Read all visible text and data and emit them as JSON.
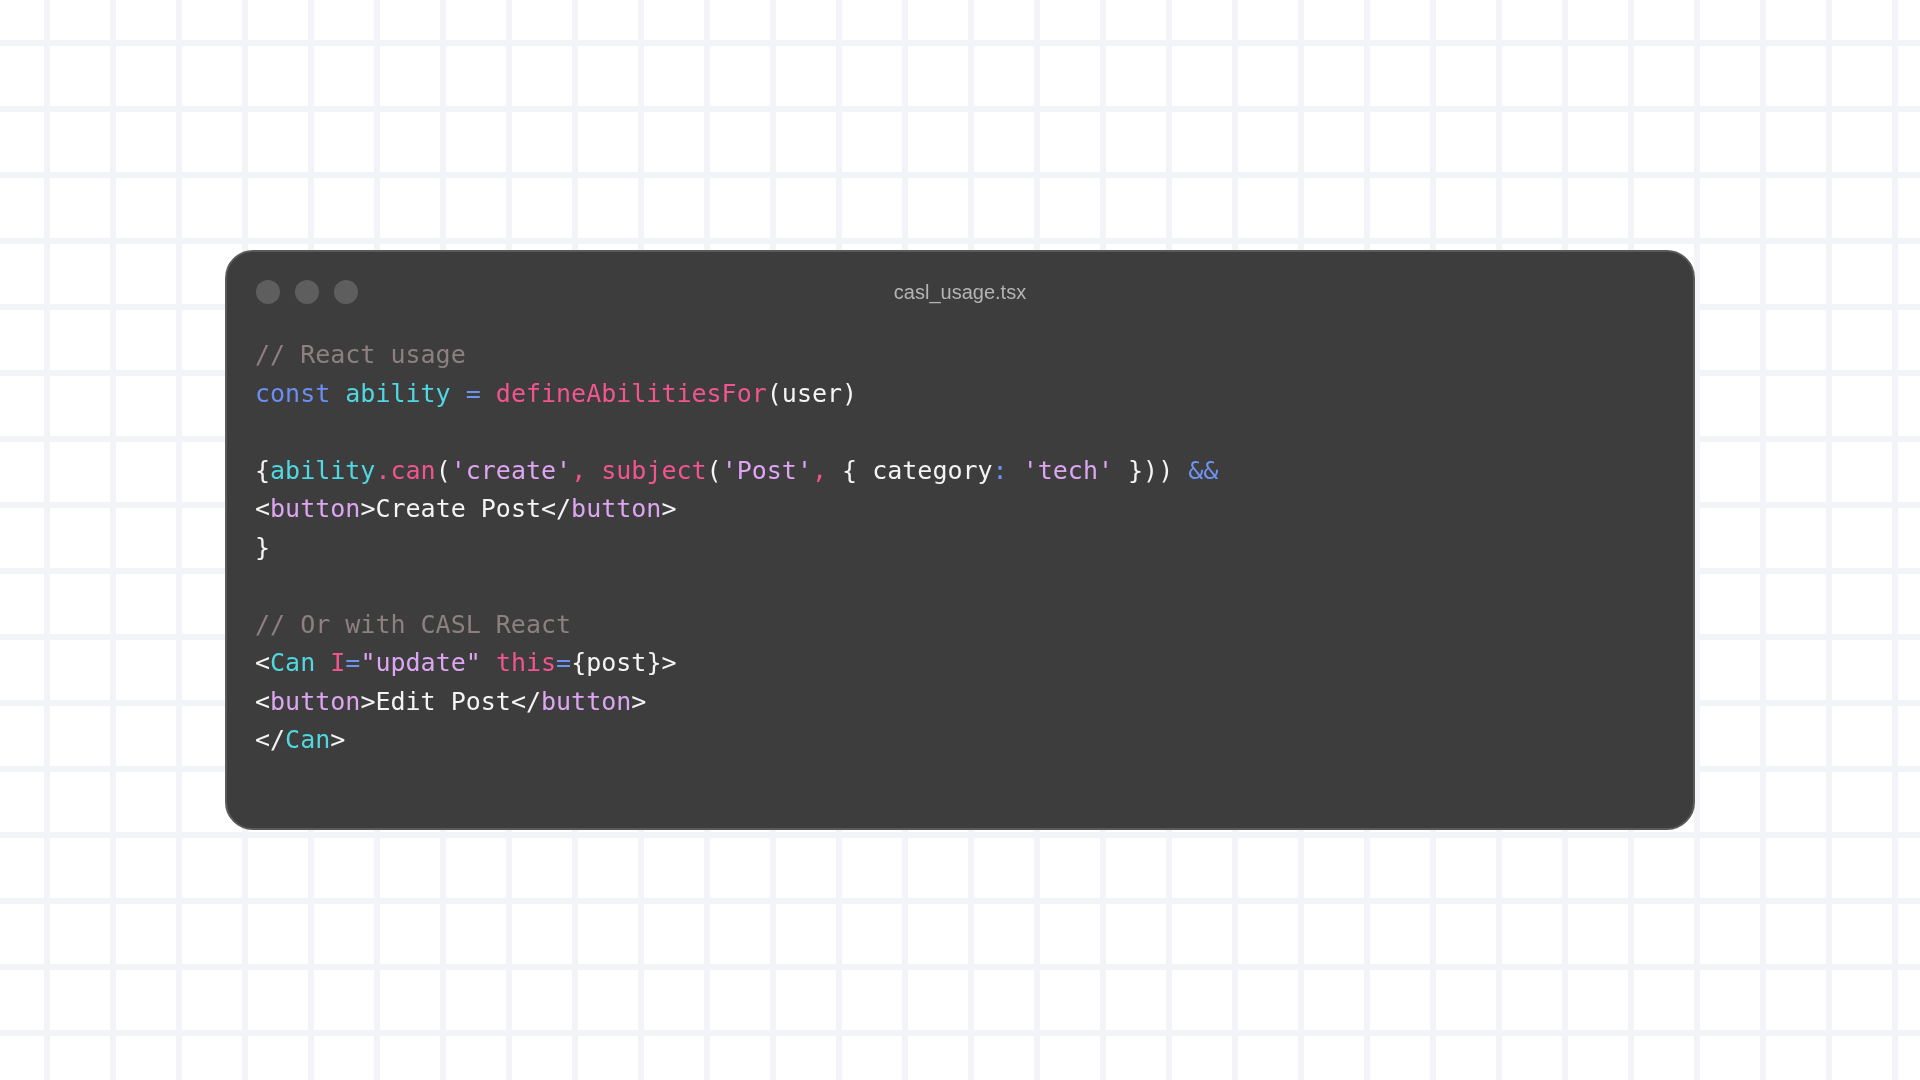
{
  "window": {
    "title": "casl_usage.tsx"
  },
  "code_lines": [
    {
      "kind": "code",
      "tokens": [
        {
          "kind": "comment",
          "text": "// React usage"
        }
      ]
    },
    {
      "kind": "code",
      "tokens": [
        {
          "kind": "keyword",
          "text": "const "
        },
        {
          "kind": "variable",
          "text": "ability "
        },
        {
          "kind": "operator",
          "text": "= "
        },
        {
          "kind": "function",
          "text": "defineAbilitiesFor"
        },
        {
          "kind": "plain",
          "text": "(user)"
        }
      ]
    },
    {
      "kind": "blank"
    },
    {
      "kind": "code",
      "tokens": [
        {
          "kind": "plain",
          "text": "{"
        },
        {
          "kind": "variable",
          "text": "ability"
        },
        {
          "kind": "function",
          "text": ".can"
        },
        {
          "kind": "plain",
          "text": "("
        },
        {
          "kind": "string",
          "text": "'create'"
        },
        {
          "kind": "function",
          "text": ", subject"
        },
        {
          "kind": "plain",
          "text": "("
        },
        {
          "kind": "string",
          "text": "'Post'"
        },
        {
          "kind": "function",
          "text": ", "
        },
        {
          "kind": "plain",
          "text": "{ category"
        },
        {
          "kind": "operator",
          "text": ": "
        },
        {
          "kind": "string",
          "text": "'tech'"
        },
        {
          "kind": "plain",
          "text": " })) "
        },
        {
          "kind": "operator",
          "text": "&&"
        }
      ]
    },
    {
      "kind": "code",
      "tokens": [
        {
          "kind": "plain",
          "text": "<"
        },
        {
          "kind": "string",
          "text": "button"
        },
        {
          "kind": "plain",
          "text": ">Create Post</"
        },
        {
          "kind": "string",
          "text": "button"
        },
        {
          "kind": "plain",
          "text": ">"
        }
      ]
    },
    {
      "kind": "code",
      "tokens": [
        {
          "kind": "plain",
          "text": "}"
        }
      ]
    },
    {
      "kind": "blank"
    },
    {
      "kind": "code",
      "tokens": [
        {
          "kind": "comment",
          "text": "// Or with CASL React"
        }
      ]
    },
    {
      "kind": "code",
      "tokens": [
        {
          "kind": "plain",
          "text": "<"
        },
        {
          "kind": "variable",
          "text": "Can "
        },
        {
          "kind": "function",
          "text": "I"
        },
        {
          "kind": "operator",
          "text": "="
        },
        {
          "kind": "string",
          "text": "\"update\" "
        },
        {
          "kind": "function",
          "text": "this"
        },
        {
          "kind": "operator",
          "text": "="
        },
        {
          "kind": "plain",
          "text": "{post}>"
        }
      ]
    },
    {
      "kind": "code",
      "tokens": [
        {
          "kind": "plain",
          "text": "<"
        },
        {
          "kind": "string",
          "text": "button"
        },
        {
          "kind": "plain",
          "text": ">Edit Post</"
        },
        {
          "kind": "string",
          "text": "button"
        },
        {
          "kind": "plain",
          "text": ">"
        }
      ]
    },
    {
      "kind": "code",
      "tokens": [
        {
          "kind": "plain",
          "text": "</"
        },
        {
          "kind": "variable",
          "text": "Can"
        },
        {
          "kind": "plain",
          "text": ">"
        }
      ]
    }
  ]
}
